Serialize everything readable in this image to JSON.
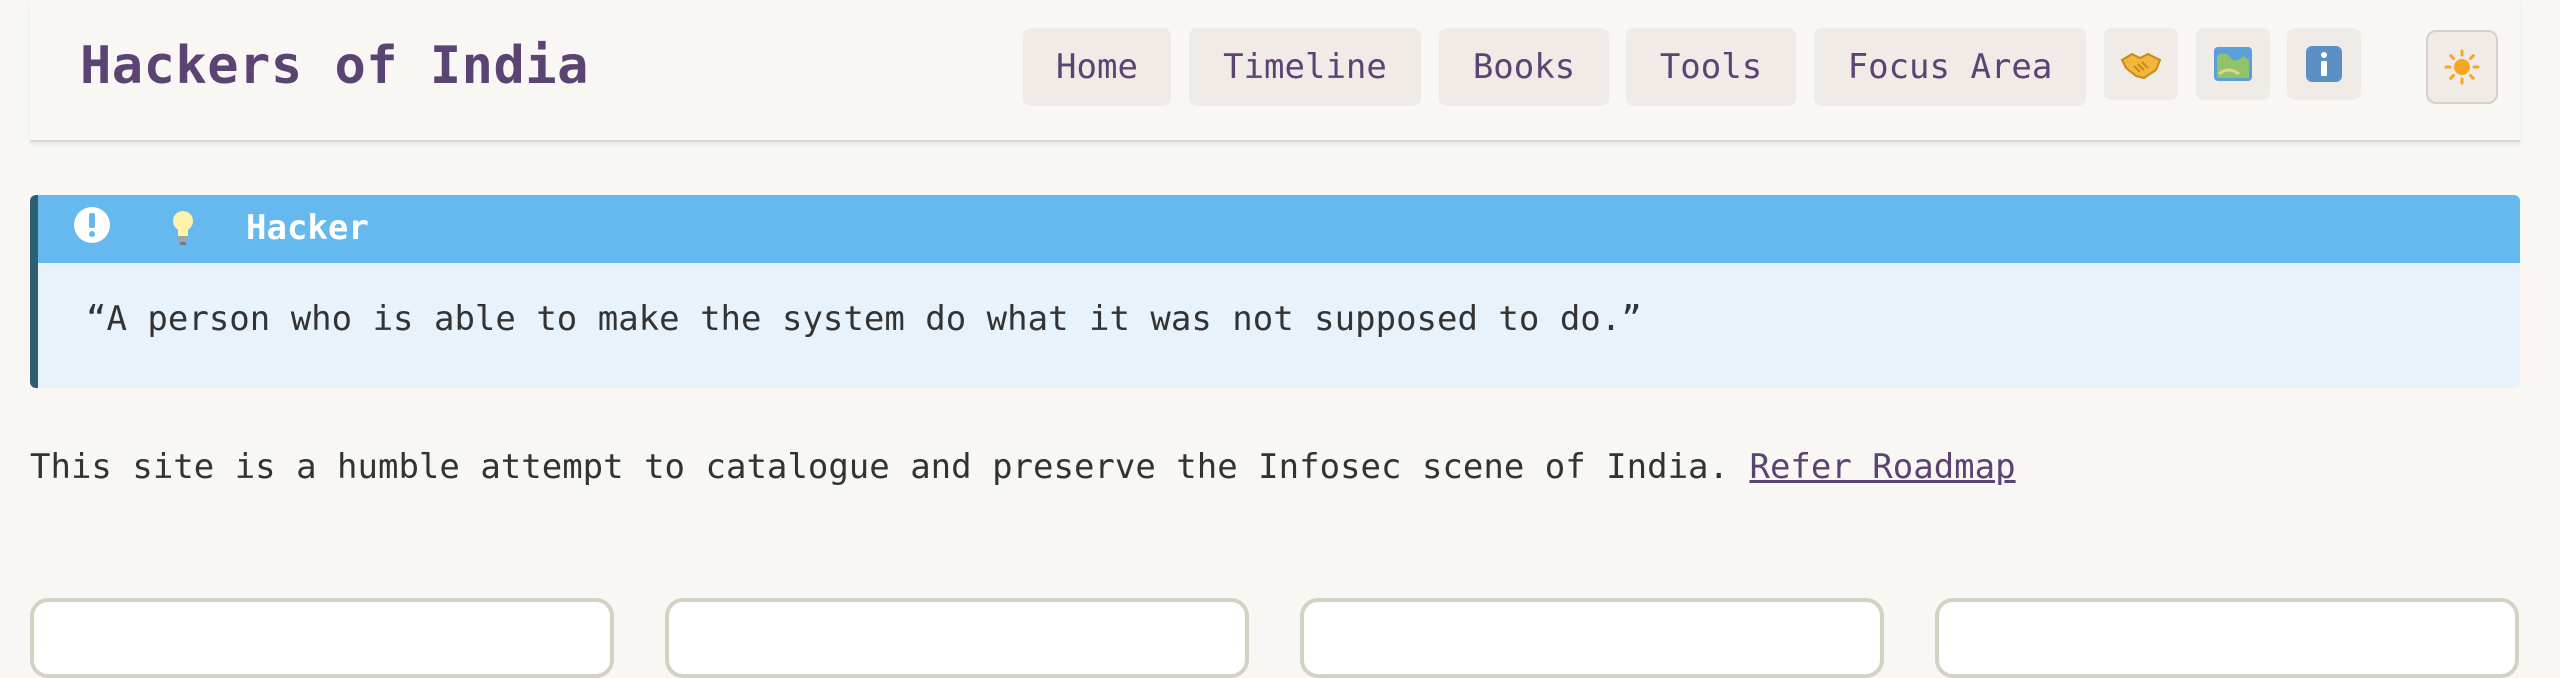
{
  "header": {
    "title": "Hackers of India",
    "nav": [
      {
        "label": "Home"
      },
      {
        "label": "Timeline"
      },
      {
        "label": "Books"
      },
      {
        "label": "Tools"
      },
      {
        "label": "Focus Area"
      }
    ],
    "icon_buttons": [
      {
        "icon": "handshake-icon",
        "glyph": "🤝"
      },
      {
        "icon": "map-icon",
        "glyph": "🗺️"
      },
      {
        "icon": "info-icon",
        "glyph": "ℹ️"
      }
    ],
    "theme_toggle": {
      "icon": "sun-icon",
      "glyph": "☀️"
    }
  },
  "callout": {
    "title": "Hacker",
    "quote": "“A person who is able to make the system do what it was not supposed to do.”"
  },
  "intro": {
    "text": "This site is a humble attempt to catalogue and preserve the Infosec scene of India.",
    "link_label": "Refer Roadmap"
  },
  "colors": {
    "brand": "#5b4373",
    "callout_header": "#66b9ee",
    "callout_body": "#e8f2fb",
    "callout_border": "#2c5f6f",
    "nav_bg": "#f0ebe7",
    "page_bg": "#f8f7f4"
  }
}
